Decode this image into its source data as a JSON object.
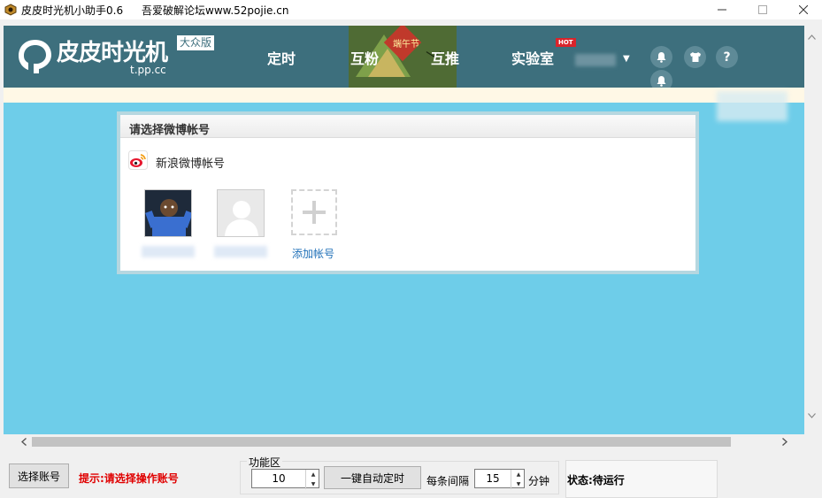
{
  "window": {
    "title": "皮皮时光机小助手0.6",
    "url_label": "吾爱破解论坛www.52pojie.cn"
  },
  "site": {
    "logo_name": "皮皮时光机",
    "logo_badge": "大众版",
    "logo_domain": "t.pp.cc",
    "nav": [
      {
        "label": "定时"
      },
      {
        "label": "互粉"
      },
      {
        "label": "互推"
      },
      {
        "label": "实验室"
      }
    ],
    "hot_badge": "HOT",
    "promo_text": "端午节",
    "help_glyph": "?"
  },
  "panel": {
    "title": "请选择微博帐号",
    "provider_label": "新浪微博帐号",
    "add_label": "添加帐号"
  },
  "toolbar": {
    "select_account_label": "选择账号",
    "hint": "提示:请选择操作账号",
    "group_title": "功能区",
    "interval_value": "10",
    "auto_schedule_label": "一键自动定时",
    "per_item_label": "每条间隔",
    "minutes_value": "15",
    "minutes_unit": "分钟",
    "status": "状态:待运行"
  },
  "colors": {
    "header": "#3d6f7d",
    "frame_bg": "#6ecde9",
    "hint_red": "#e00000",
    "link_blue": "#1f70b8"
  }
}
